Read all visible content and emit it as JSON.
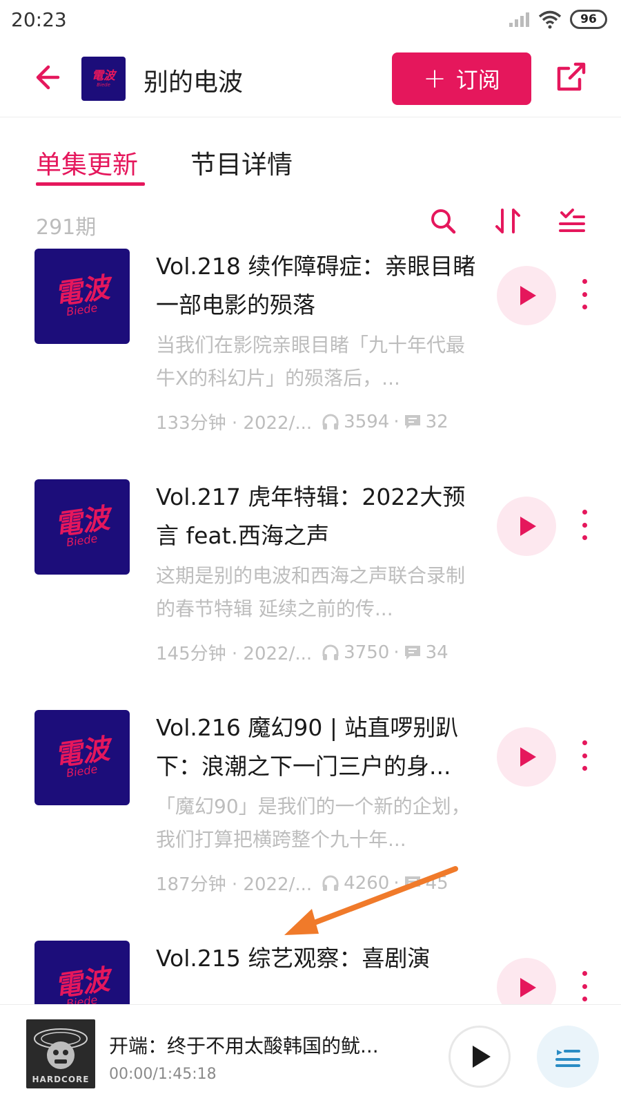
{
  "status": {
    "time": "20:23",
    "battery": "96"
  },
  "header": {
    "logo_text": "電波",
    "logo_sub": "Biede",
    "title": "别的电波",
    "subscribe_label": "订阅"
  },
  "tabs": [
    {
      "label": "单集更新",
      "active": true
    },
    {
      "label": "节目详情",
      "active": false
    }
  ],
  "toolbar": {
    "count": "291期"
  },
  "episodes": [
    {
      "thumb_text": "電波",
      "thumb_sub": "Biede",
      "title": "Vol.218 续作障碍症：亲眼目睹一部电影的殒落",
      "desc": "当我们在影院亲眼目睹「九十年代最牛X的科幻片」的殒落后，...",
      "duration_date": "133分钟 · 2022/...",
      "plays": "3594",
      "comments": "32"
    },
    {
      "thumb_text": "電波",
      "thumb_sub": "Biede",
      "title": "Vol.217 虎年特辑：2022大预言 feat.西海之声",
      "desc": "这期是别的电波和西海之声联合录制的春节特辑 延续之前的传...",
      "duration_date": "145分钟 · 2022/...",
      "plays": "3750",
      "comments": "34"
    },
    {
      "thumb_text": "電波",
      "thumb_sub": "Biede",
      "title": "Vol.216 魔幻90 | 站直啰别趴下：浪潮之下一门三户的身...",
      "desc": "「魔幻90」是我们的一个新的企划，我们打算把横跨整个九十年...",
      "duration_date": "187分钟 · 2022/...",
      "plays": "4260",
      "comments": "45"
    },
    {
      "thumb_text": "電波",
      "thumb_sub": "Biede",
      "title": "Vol.215 综艺观察：喜剧演"
    }
  ],
  "player": {
    "cover_label": "HARDCORE",
    "title": "开端：终于不用太酸韩国的鱿...",
    "time": "00:00/1:45:18"
  },
  "colors": {
    "accent": "#e5175c",
    "logo_bg": "#1c0d7a",
    "annotation_arrow": "#f07a2a"
  }
}
